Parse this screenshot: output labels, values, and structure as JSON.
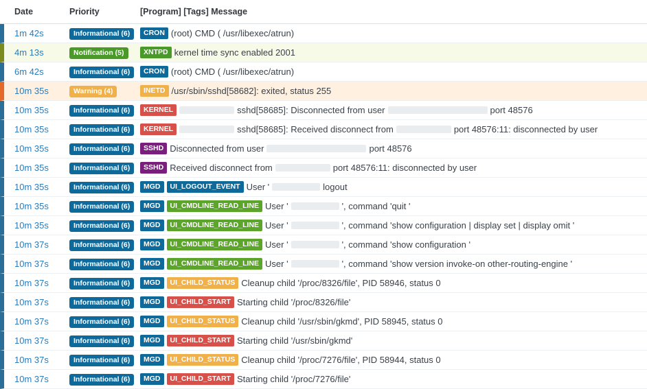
{
  "header": {
    "date": "Date",
    "priority": "Priority",
    "message": "[Program] [Tags] Message"
  },
  "rows": [
    {
      "date": "1m 42s",
      "prio": "Informational (6)",
      "level": "info",
      "program": "CRON",
      "progColor": "t-blue",
      "parts": [
        {
          "t": "(root) CMD ( /usr/libexec/atrun)"
        }
      ]
    },
    {
      "date": "4m 13s",
      "prio": "Notification (5)",
      "level": "notice",
      "program": "XNTPD",
      "progColor": "t-green",
      "parts": [
        {
          "t": "kernel time sync enabled 2001"
        }
      ]
    },
    {
      "date": "6m 42s",
      "prio": "Informational (6)",
      "level": "info",
      "program": "CRON",
      "progColor": "t-blue",
      "parts": [
        {
          "t": "(root) CMD ( /usr/libexec/atrun)"
        }
      ]
    },
    {
      "date": "10m 35s",
      "prio": "Warning (4)",
      "level": "warn",
      "program": "INETD",
      "progColor": "t-orange",
      "parts": [
        {
          "t": "/usr/sbin/sshd[58682]: exited, status 255"
        }
      ]
    },
    {
      "date": "10m 35s",
      "prio": "Informational (6)",
      "level": "info",
      "program": "KERNEL",
      "progColor": "t-red",
      "parts": [
        {
          "b": 80
        },
        {
          "t": "sshd[58685]: Disconnected from user"
        },
        {
          "b": 145
        },
        {
          "t": "port 48576"
        }
      ]
    },
    {
      "date": "10m 35s",
      "prio": "Informational (6)",
      "level": "info",
      "program": "KERNEL",
      "progColor": "t-red",
      "parts": [
        {
          "b": 80
        },
        {
          "t": "sshd[58685]: Received disconnect from"
        },
        {
          "b": 80
        },
        {
          "t": "port 48576:11: disconnected by user"
        }
      ]
    },
    {
      "date": "10m 35s",
      "prio": "Informational (6)",
      "level": "info",
      "program": "SSHD",
      "progColor": "t-purple",
      "parts": [
        {
          "t": "Disconnected from user"
        },
        {
          "b": 145
        },
        {
          "t": "port 48576"
        }
      ]
    },
    {
      "date": "10m 35s",
      "prio": "Informational (6)",
      "level": "info",
      "program": "SSHD",
      "progColor": "t-purple",
      "parts": [
        {
          "t": "Received disconnect from"
        },
        {
          "b": 80
        },
        {
          "t": "port 48576:11: disconnected by user"
        }
      ]
    },
    {
      "date": "10m 35s",
      "prio": "Informational (6)",
      "level": "info",
      "program": "MGD",
      "progColor": "t-blue",
      "tag": "UI_LOGOUT_EVENT",
      "tagColor": "t-blue",
      "parts": [
        {
          "t": "User '"
        },
        {
          "b": 70
        },
        {
          "t": "logout"
        }
      ]
    },
    {
      "date": "10m 35s",
      "prio": "Informational (6)",
      "level": "info",
      "program": "MGD",
      "progColor": "t-blue",
      "tag": "UI_CMDLINE_READ_LINE",
      "tagColor": "t-lime",
      "parts": [
        {
          "t": "User '"
        },
        {
          "b": 70
        },
        {
          "t": "', command 'quit '"
        }
      ]
    },
    {
      "date": "10m 35s",
      "prio": "Informational (6)",
      "level": "info",
      "program": "MGD",
      "progColor": "t-blue",
      "tag": "UI_CMDLINE_READ_LINE",
      "tagColor": "t-lime",
      "parts": [
        {
          "t": "User '"
        },
        {
          "b": 70
        },
        {
          "t": "', command 'show configuration | display set | display omit '"
        }
      ]
    },
    {
      "date": "10m 37s",
      "prio": "Informational (6)",
      "level": "info",
      "program": "MGD",
      "progColor": "t-blue",
      "tag": "UI_CMDLINE_READ_LINE",
      "tagColor": "t-lime",
      "parts": [
        {
          "t": "User '"
        },
        {
          "b": 70
        },
        {
          "t": "', command 'show configuration '"
        }
      ]
    },
    {
      "date": "10m 37s",
      "prio": "Informational (6)",
      "level": "info",
      "program": "MGD",
      "progColor": "t-blue",
      "tag": "UI_CMDLINE_READ_LINE",
      "tagColor": "t-lime",
      "parts": [
        {
          "t": "User '"
        },
        {
          "b": 70
        },
        {
          "t": "', command 'show version invoke-on other-routing-engine '"
        }
      ]
    },
    {
      "date": "10m 37s",
      "prio": "Informational (6)",
      "level": "info",
      "program": "MGD",
      "progColor": "t-blue",
      "tag": "UI_CHILD_STATUS",
      "tagColor": "t-orange",
      "parts": [
        {
          "t": "Cleanup child '/proc/8326/file', PID 58946, status 0"
        }
      ]
    },
    {
      "date": "10m 37s",
      "prio": "Informational (6)",
      "level": "info",
      "program": "MGD",
      "progColor": "t-blue",
      "tag": "UI_CHILD_START",
      "tagColor": "t-red",
      "parts": [
        {
          "t": "Starting child '/proc/8326/file'"
        }
      ]
    },
    {
      "date": "10m 37s",
      "prio": "Informational (6)",
      "level": "info",
      "program": "MGD",
      "progColor": "t-blue",
      "tag": "UI_CHILD_STATUS",
      "tagColor": "t-orange",
      "parts": [
        {
          "t": "Cleanup child '/usr/sbin/gkmd', PID 58945, status 0"
        }
      ]
    },
    {
      "date": "10m 37s",
      "prio": "Informational (6)",
      "level": "info",
      "program": "MGD",
      "progColor": "t-blue",
      "tag": "UI_CHILD_START",
      "tagColor": "t-red",
      "parts": [
        {
          "t": "Starting child '/usr/sbin/gkmd'"
        }
      ]
    },
    {
      "date": "10m 37s",
      "prio": "Informational (6)",
      "level": "info",
      "program": "MGD",
      "progColor": "t-blue",
      "tag": "UI_CHILD_STATUS",
      "tagColor": "t-orange",
      "parts": [
        {
          "t": "Cleanup child '/proc/7276/file', PID 58944, status 0"
        }
      ]
    },
    {
      "date": "10m 37s",
      "prio": "Informational (6)",
      "level": "info",
      "program": "MGD",
      "progColor": "t-blue",
      "tag": "UI_CHILD_START",
      "tagColor": "t-red",
      "parts": [
        {
          "t": "Starting child '/proc/7276/file'"
        }
      ]
    }
  ]
}
